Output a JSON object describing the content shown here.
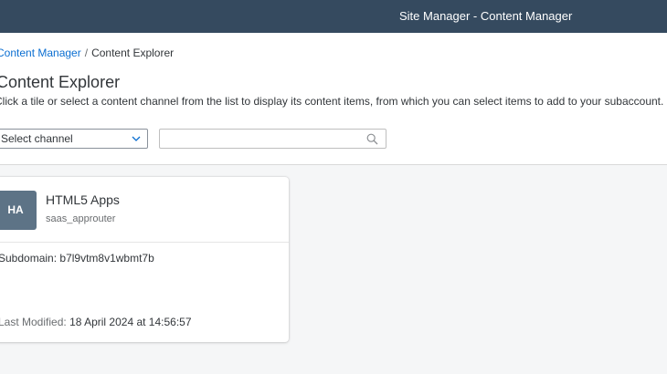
{
  "header": {
    "title": "Site Manager - Content Manager"
  },
  "breadcrumb": {
    "link": "Content Manager",
    "separator": "/",
    "current": "Content Explorer"
  },
  "page": {
    "title": "Content Explorer",
    "description": "Click a tile or select a content channel from the list to display its content items, from which you can select items to add to your subaccount."
  },
  "filters": {
    "channel_select_value": "Select channel",
    "search_value": "",
    "search_placeholder": ""
  },
  "tiles": [
    {
      "avatar_initials": "HA",
      "title": "HTML5 Apps",
      "subtitle": "saas_approuter",
      "subdomain_label": "Subdomain:",
      "subdomain_value": "b7l9vtm8v1wbmt7b",
      "modified_label": "Last Modified:",
      "modified_value": "18 April 2024 at 14:56:57"
    }
  ],
  "colors": {
    "shell_bar": "#354a5f",
    "link": "#0a6ed1",
    "avatar": "#5d7386",
    "page_background": "#f5f6f7"
  },
  "icons": {
    "channel_dropdown": "chevron-down-icon",
    "search": "search-icon"
  }
}
